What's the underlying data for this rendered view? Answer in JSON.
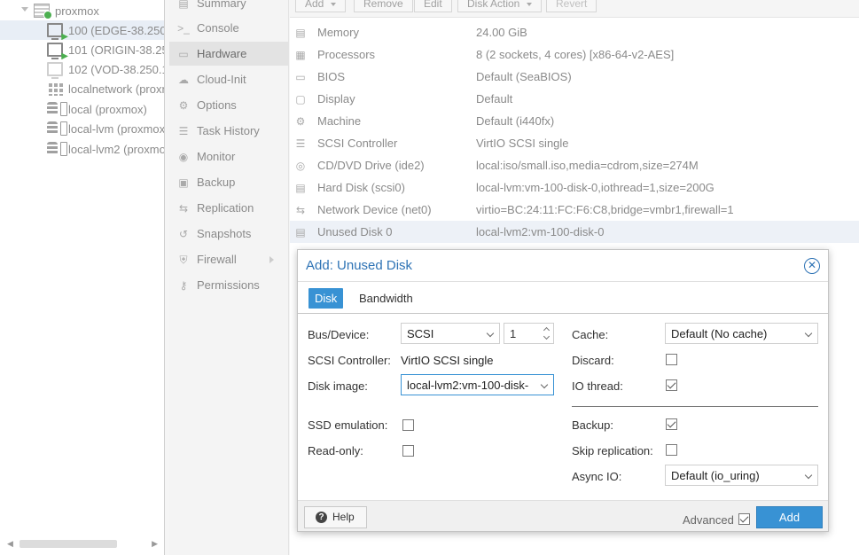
{
  "tree": {
    "items": [
      {
        "label": "proxmox",
        "icon": "server-icon"
      },
      {
        "label": "100 (EDGE-38.250.",
        "icon": "vm-running-icon"
      },
      {
        "label": "101 (ORIGIN-38.25",
        "icon": "vm-running-icon"
      },
      {
        "label": "102 (VOD-38.250.1",
        "icon": "vm-stopped-icon"
      },
      {
        "label": "localnetwork (proxm",
        "icon": "network-grid-icon"
      },
      {
        "label": "local (proxmox)",
        "icon": "storage-icon"
      },
      {
        "label": "local-lvm (proxmox",
        "icon": "storage-icon"
      },
      {
        "label": "local-lvm2 (proxmo",
        "icon": "storage-icon"
      }
    ]
  },
  "nav": {
    "items": [
      {
        "label": "Summary",
        "icon": "summary-icon"
      },
      {
        "label": "Console",
        "icon": "console-icon"
      },
      {
        "label": "Hardware",
        "icon": "monitor-icon"
      },
      {
        "label": "Cloud-Init",
        "icon": "cloud-icon"
      },
      {
        "label": "Options",
        "icon": "gear-icon"
      },
      {
        "label": "Task History",
        "icon": "list-icon"
      },
      {
        "label": "Monitor",
        "icon": "eye-icon"
      },
      {
        "label": "Backup",
        "icon": "floppy-icon"
      },
      {
        "label": "Replication",
        "icon": "retweet-icon"
      },
      {
        "label": "Snapshots",
        "icon": "history-icon"
      },
      {
        "label": "Firewall",
        "icon": "shield-icon"
      },
      {
        "label": "Permissions",
        "icon": "unlock-icon"
      }
    ]
  },
  "toolbar": {
    "add": "Add",
    "remove": "Remove",
    "edit": "Edit",
    "disk_action": "Disk Action",
    "revert": "Revert"
  },
  "hardware": {
    "rows": [
      {
        "label": "Memory",
        "value": "24.00 GiB",
        "icon": "memory-icon"
      },
      {
        "label": "Processors",
        "value": "8 (2 sockets, 4 cores) [x86-64-v2-AES]",
        "icon": "cpu-icon"
      },
      {
        "label": "BIOS",
        "value": "Default (SeaBIOS)",
        "icon": "microchip-icon"
      },
      {
        "label": "Display",
        "value": "Default",
        "icon": "desktop-icon"
      },
      {
        "label": "Machine",
        "value": "Default (i440fx)",
        "icon": "cogs-icon"
      },
      {
        "label": "SCSI Controller",
        "value": "VirtIO SCSI single",
        "icon": "database-icon"
      },
      {
        "label": "CD/DVD Drive (ide2)",
        "value": "local:iso/small.iso,media=cdrom,size=274M",
        "icon": "cdrom-icon"
      },
      {
        "label": "Hard Disk (scsi0)",
        "value": "local-lvm:vm-100-disk-0,iothread=1,size=200G",
        "icon": "hdd-icon"
      },
      {
        "label": "Network Device (net0)",
        "value": "virtio=BC:24:11:FC:F6:C8,bridge=vmbr1,firewall=1",
        "icon": "exchange-icon"
      },
      {
        "label": "Unused Disk 0",
        "value": "local-lvm2:vm-100-disk-0",
        "icon": "hdd-icon"
      }
    ]
  },
  "dialog": {
    "title": "Add: Unused Disk",
    "tabs": [
      "Disk",
      "Bandwidth"
    ],
    "bus_device_label": "Bus/Device:",
    "bus_value": "SCSI",
    "device_number": "1",
    "scsi_controller_label": "SCSI Controller:",
    "scsi_controller_value": "VirtIO SCSI single",
    "disk_image_label": "Disk image:",
    "disk_image_value": "local-lvm2:vm-100-disk-",
    "cache_label": "Cache:",
    "cache_value": "Default (No cache)",
    "discard_label": "Discard:",
    "discard_checked": false,
    "io_thread_label": "IO thread:",
    "io_thread_checked": true,
    "ssd_emulation_label": "SSD emulation:",
    "ssd_emulation_checked": false,
    "read_only_label": "Read-only:",
    "read_only_checked": false,
    "backup_label": "Backup:",
    "backup_checked": true,
    "skip_replication_label": "Skip replication:",
    "skip_replication_checked": false,
    "async_io_label": "Async IO:",
    "async_io_value": "Default (io_uring)",
    "help_label": "Help",
    "advanced_label": "Advanced",
    "advanced_checked": true,
    "add_label": "Add"
  },
  "colors": {
    "accent": "#3892d4",
    "title_blue": "#2e73b5",
    "running_green": "#4caf50"
  }
}
